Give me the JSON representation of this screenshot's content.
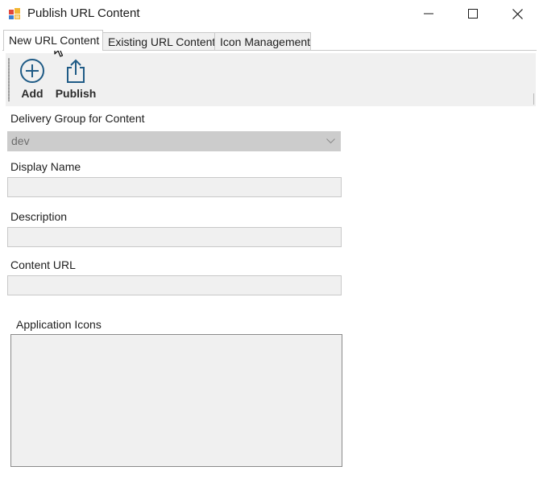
{
  "window": {
    "title": "Publish URL Content",
    "controls": [
      "minimize",
      "maximize",
      "close"
    ]
  },
  "tabs": [
    {
      "label": "New URL Content",
      "active": true
    },
    {
      "label": "Existing URL Content",
      "active": false
    },
    {
      "label": "Icon Management",
      "active": false
    }
  ],
  "toolbar": {
    "add_label": "Add",
    "publish_label": "Publish",
    "add_icon": "add-circle-icon",
    "publish_icon": "share-upload-icon",
    "accent": "#1f5b86"
  },
  "form": {
    "delivery_group_label": "Delivery Group for Content",
    "delivery_group_value": "dev",
    "display_name_label": "Display Name",
    "display_name_value": "",
    "description_label": "Description",
    "description_value": "",
    "content_url_label": "Content URL",
    "content_url_value": "",
    "application_icons_label": "Application Icons"
  }
}
